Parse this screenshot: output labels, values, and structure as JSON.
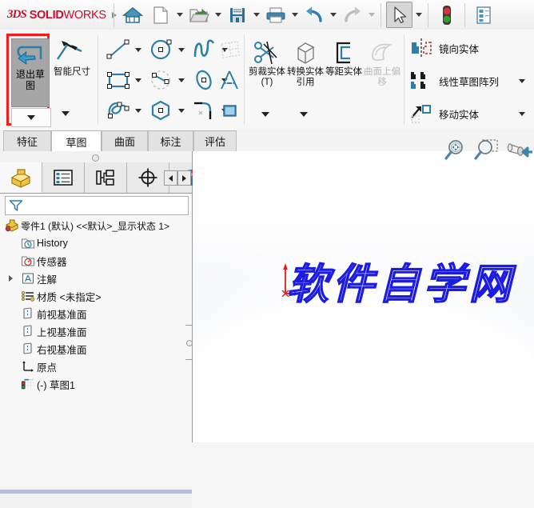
{
  "app": {
    "brand_ds": "3DS",
    "brand_name_bold": "SOLID",
    "brand_name_light": "WORKS",
    "brand_color": "#c8102e"
  },
  "quick_access": {
    "items": [
      {
        "name": "home-icon",
        "label": "主页",
        "has_dropdown": false
      },
      {
        "name": "new-document-icon",
        "label": "新建",
        "has_dropdown": true
      },
      {
        "name": "open-folder-icon",
        "label": "打开",
        "has_dropdown": true
      },
      {
        "name": "save-icon",
        "label": "保存",
        "has_dropdown": true
      },
      {
        "name": "print-icon",
        "label": "打印",
        "has_dropdown": true
      },
      {
        "name": "undo-icon",
        "label": "撤销",
        "has_dropdown": true
      },
      {
        "name": "redo-icon",
        "label": "重做",
        "has_dropdown": true
      },
      {
        "name": "select-arrow-icon",
        "label": "选择",
        "has_dropdown": true
      },
      {
        "name": "rebuild-traffic-light-icon",
        "label": "重建模型",
        "has_dropdown": false
      },
      {
        "name": "options-panel-icon",
        "label": "选项",
        "has_dropdown": false
      }
    ]
  },
  "ribbon": {
    "exit_sketch": {
      "label": "退出草图",
      "selected": true,
      "highlighted": true,
      "highlight_color": "#ff1a1a"
    },
    "smart_dimension": {
      "label": "智能尺寸"
    },
    "sketch_entities": [
      {
        "name": "line-tool-icon",
        "label": "直线"
      },
      {
        "name": "rectangle-tool-icon",
        "label": "边角矩形"
      },
      {
        "name": "spline-tool-icon",
        "label": "样条曲线"
      },
      {
        "name": "circle-tool-icon",
        "label": "圆"
      },
      {
        "name": "centerpoint-arc-tool-icon",
        "label": "圆心/起/终点画弧"
      },
      {
        "name": "polygon-tool-icon",
        "label": "多边形"
      },
      {
        "name": "sketch-fillet-tool-icon",
        "label": "绘制圆角"
      },
      {
        "name": "ellipse-tool-icon",
        "label": "椭圆"
      },
      {
        "name": "curve-tool-icon",
        "label": "曲线"
      },
      {
        "name": "plane-tool-icon",
        "label": "基准面"
      },
      {
        "name": "text-tool-icon",
        "label": "文字"
      },
      {
        "name": "shaded-sketch-contour-icon",
        "label": "上色草图轮廓"
      }
    ],
    "modify_group": [
      {
        "name": "trim-entities-icon",
        "label": "剪裁实体(T)",
        "disabled": false,
        "has_dropdown": true
      },
      {
        "name": "convert-entities-icon",
        "label": "转换实体引用",
        "disabled": false,
        "has_dropdown": true
      },
      {
        "name": "offset-entities-icon",
        "label": "等距实体",
        "disabled": false,
        "has_dropdown": false
      },
      {
        "name": "offset-on-surface-icon",
        "label": "曲面上偏移",
        "disabled": true,
        "has_dropdown": false
      }
    ],
    "pattern_group": [
      {
        "name": "mirror-entities-icon",
        "label": "镜向实体",
        "has_dropdown": false
      },
      {
        "name": "linear-sketch-pattern-icon",
        "label": "线性草图阵列",
        "has_dropdown": true
      },
      {
        "name": "move-entities-icon",
        "label": "移动实体",
        "has_dropdown": true
      }
    ]
  },
  "command_tabs": {
    "active": "草图",
    "items": [
      {
        "label": "特征"
      },
      {
        "label": "草图"
      },
      {
        "label": "曲面"
      },
      {
        "label": "标注"
      },
      {
        "label": "评估"
      }
    ]
  },
  "feature_manager": {
    "tabs": [
      {
        "name": "feature-tree-tab",
        "label": "FeatureManager 设计树",
        "active": true
      },
      {
        "name": "property-manager-tab",
        "label": "PropertyManager",
        "active": false
      },
      {
        "name": "configuration-manager-tab",
        "label": "ConfigurationManager",
        "active": false
      },
      {
        "name": "dimxpert-manager-tab",
        "label": "DimXpertManager",
        "active": false
      },
      {
        "name": "display-manager-tab",
        "label": "DisplayManager",
        "active": false
      }
    ],
    "nav": {
      "prev": "◄",
      "next": "►"
    },
    "filter_placeholder": "",
    "tree": [
      {
        "label": "零件1 (默认) <<默认>_显示状态 1>",
        "icon": "part-icon",
        "indent": 0,
        "twisty": false,
        "root": true
      },
      {
        "label": "History",
        "icon": "history-folder-icon",
        "indent": 1,
        "twisty": false
      },
      {
        "label": "传感器",
        "icon": "sensors-folder-icon",
        "indent": 1,
        "twisty": false
      },
      {
        "label": "注解",
        "icon": "annotations-folder-icon",
        "indent": 1,
        "twisty": true
      },
      {
        "label": "材质 <未指定>",
        "icon": "material-icon",
        "indent": 1,
        "twisty": false
      },
      {
        "label": "前视基准面",
        "icon": "plane-icon",
        "indent": 1,
        "twisty": false
      },
      {
        "label": "上视基准面",
        "icon": "plane-icon",
        "indent": 1,
        "twisty": false
      },
      {
        "label": "右视基准面",
        "icon": "plane-icon",
        "indent": 1,
        "twisty": false
      },
      {
        "label": "原点",
        "icon": "origin-icon",
        "indent": 1,
        "twisty": false
      },
      {
        "label": "(-) 草图1",
        "icon": "sketch-icon",
        "indent": 1,
        "twisty": false
      }
    ]
  },
  "view_toolbar": [
    {
      "name": "zoom-to-fit-icon",
      "label": "整屏显示全图"
    },
    {
      "name": "zoom-to-area-icon",
      "label": "局部放大"
    },
    {
      "name": "view-orientation-icon",
      "label": "视图定向"
    }
  ],
  "graphics": {
    "sketch_text": "软件自学网",
    "sketch_color": "#1c1ce0",
    "origin_color": "#e01b1b"
  }
}
